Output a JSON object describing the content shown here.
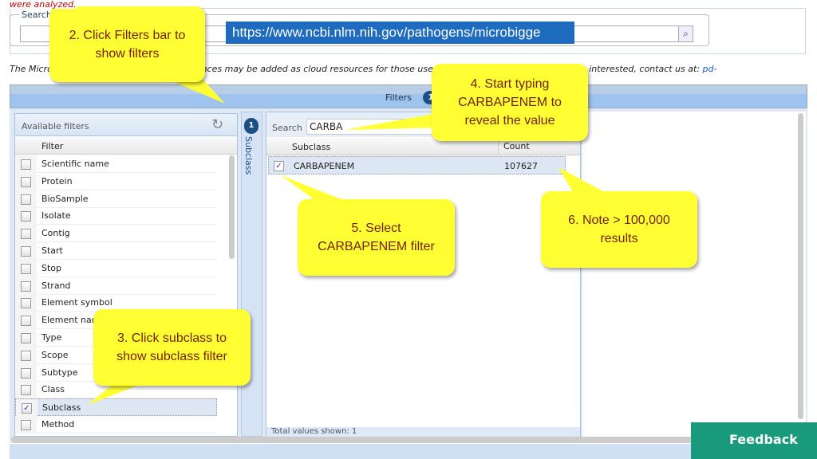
{
  "top_note": "were analyzed.",
  "search": {
    "legend": "Search",
    "value": "",
    "button_icon": "search-icon"
  },
  "url": "https://www.ncbi.nlm.nih.gov/pathogens/microbigge",
  "info": {
    "text_start": "The Micro",
    "text_mid": "ences may be added as cloud resources for those users in",
    "text_end": "are interested, contact us at: ",
    "link": "pd-"
  },
  "filters_bar": {
    "label": "Filters",
    "count": "1"
  },
  "available_filters": {
    "title": "Available filters",
    "refresh_icon": "refresh-icon",
    "column": "Filter",
    "items": [
      {
        "label": "Scientific name",
        "checked": false
      },
      {
        "label": "Protein",
        "checked": false
      },
      {
        "label": "BioSample",
        "checked": false
      },
      {
        "label": "Isolate",
        "checked": false
      },
      {
        "label": "Contig",
        "checked": false
      },
      {
        "label": "Start",
        "checked": false
      },
      {
        "label": "Stop",
        "checked": false
      },
      {
        "label": "Strand",
        "checked": false
      },
      {
        "label": "Element symbol",
        "checked": false
      },
      {
        "label": "Element name",
        "checked": false
      },
      {
        "label": "Type",
        "checked": false
      },
      {
        "label": "Scope",
        "checked": false
      },
      {
        "label": "Subtype",
        "checked": false
      },
      {
        "label": "Class",
        "checked": false
      },
      {
        "label": "Subclass",
        "checked": true
      },
      {
        "label": "Method",
        "checked": false
      }
    ]
  },
  "active_filter_tab": {
    "count": "1",
    "label": "Subclass"
  },
  "subclass_panel": {
    "search_label": "Search",
    "search_value": "CARBA",
    "columns": [
      "Subclass",
      "Count"
    ],
    "rows": [
      {
        "subclass": "CARBAPENEM",
        "count": "107627",
        "checked": true
      }
    ],
    "footer": "Total values shown: 1"
  },
  "feedback": "Feedback",
  "callouts": {
    "c2": "2. Click Filters bar to show filters",
    "c3": "3. Click subclass to show subclass filter",
    "c4": "4. Start typing CARBAPENEM to reveal the value",
    "c5": "5. Select CARBAPENEM filter",
    "c6": "6. Note > 100,000 results"
  },
  "colors": {
    "callout": "#ffff33",
    "callout_text": "#7a1c00",
    "url_bg": "#1e6cc0",
    "feedback": "#1a9a7c",
    "badge": "#1d4f86"
  }
}
